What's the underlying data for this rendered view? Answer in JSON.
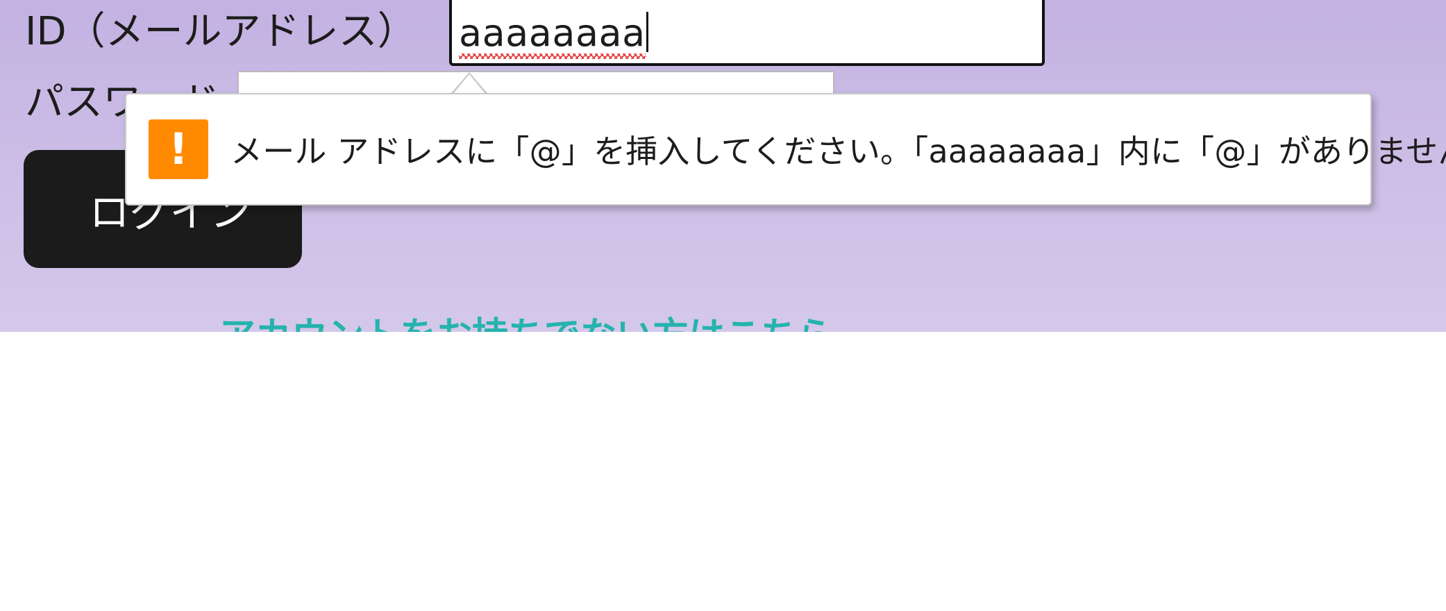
{
  "form": {
    "id_label": "ID（メールアドレス）",
    "email_value": "aaaaaaaa",
    "password_label": "パスワード",
    "login_label": "ログイン",
    "register_link": "アカウントをお持ちでない方はこちら"
  },
  "validation": {
    "icon": "warning-icon",
    "icon_glyph": "!",
    "icon_color": "#ff8a00",
    "message": "メール アドレスに「@」を挿入してください。「aaaaaaaa」内に「@」がありません。"
  },
  "colors": {
    "background": "#c3b2e2",
    "button": "#1b1b1b",
    "link": "#24b3ad",
    "spellcheck": "#e23a3a"
  }
}
